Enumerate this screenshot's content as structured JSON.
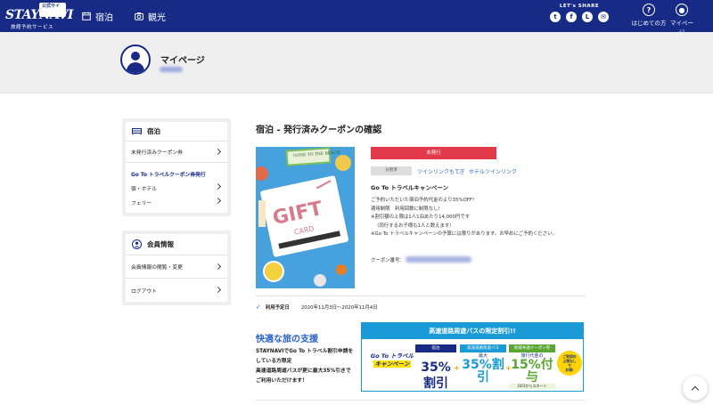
{
  "header": {
    "logo_badge": "公式サイト",
    "logo_name": "STAYNAVI",
    "logo_sub": "旅館予約サービス",
    "nav": [
      {
        "label": "宿泊",
        "icon": "calendar-icon"
      },
      {
        "label": "観光",
        "icon": "camera-icon"
      }
    ],
    "share_label": "LET's SHARE",
    "share_icons": [
      "twitter-icon",
      "facebook-icon",
      "line-icon",
      "mail-icon"
    ],
    "help_label": "はじめての方",
    "mypage_label": "マイページ",
    "brand_color": "#162a86"
  },
  "user": {
    "title": "マイページ"
  },
  "sidebar": {
    "stay": {
      "title": "宿泊",
      "items": [
        {
          "label": "未発行済みクーポン券"
        }
      ],
      "goto_label": "Go To トラベルクーポン券発行",
      "sub_items": [
        {
          "label": "宿・ホテル"
        },
        {
          "label": "フェリー"
        }
      ]
    },
    "member": {
      "title": "会員情報",
      "items": [
        {
          "label": "会員情報の閲覧・変更"
        },
        {
          "label": "ログアウト"
        }
      ]
    }
  },
  "main": {
    "title": "宿泊 - 発行済みクーポンの確認",
    "status_label": "未発行",
    "chip_label": "分割済",
    "links": [
      "ツインリンクもてぎ",
      "ホテルツインリンク"
    ],
    "campaign_title": "Go To トラベルキャンペーン",
    "description": [
      "ご予約いただいた宿泊予約代金のより35%OFF!",
      "適用制限　利用回数に制限なし!",
      "※割引額の上限は1人1泊あたり14,000円です",
      "（同行するお子様も1人と数えます）",
      "※Go To トラベルキャンペーンの予算には限りがあります。お早めにご予約ください。"
    ],
    "coupon_number_label": "クーポン番号：",
    "date_label": "利用予定日",
    "date_value": "2020年11月3日～2020年11月4日",
    "image": {
      "sign_text": "GONE TO THE BEACH",
      "gift_text": "GIFT",
      "card_text": "CARD"
    }
  },
  "support": {
    "title": "快適な旅の支援",
    "lines": [
      "STAYNAVIでGo To トラベル割引申請を",
      "している方限定",
      "高速道路周遊バスが更に最大35%引きで",
      "ご利用いただけます！"
    ]
  },
  "banner": {
    "header": "高速道路周遊バスの限定割引!!",
    "campaign_line1": "Go To トラベル",
    "campaign_line2": "キャンペーン",
    "col1_tag": "宿泊",
    "col1_value": "35%割引",
    "col2_tag": "高速道路周遊バス",
    "col2_prefix": "最大",
    "col2_value": "35%割引",
    "col3_tag": "地域共通クーポン券",
    "col3_prefix": "旅行代金の",
    "col3_value": "15%付与",
    "col3_note": "10/1からスタート",
    "burst": [
      "ご利用の",
      "上限なし",
      "で",
      "お得!"
    ]
  }
}
